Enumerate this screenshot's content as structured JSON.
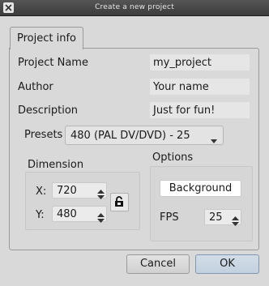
{
  "window": {
    "title": "Create a new project"
  },
  "tabs": [
    {
      "label": "Project info"
    }
  ],
  "form": {
    "project_name_label": "Project Name",
    "project_name_value": "my_project",
    "author_label": "Author",
    "author_value": "Your name",
    "description_label": "Description",
    "description_value": "Just for fun!",
    "presets_label": "Presets",
    "presets_value": "480 (PAL DV/DVD) - 25"
  },
  "dimension": {
    "title": "Dimension",
    "x_label": "X:",
    "x_value": "720",
    "y_label": "Y:",
    "y_value": "480"
  },
  "options": {
    "title": "Options",
    "background_label": "Background",
    "fps_label": "FPS",
    "fps_value": "25"
  },
  "buttons": {
    "cancel": "Cancel",
    "ok": "OK"
  },
  "icons": {
    "close": "close-icon",
    "dropdown": "chevron-down-icon",
    "lock": "lock-icon",
    "spin_up": "arrow-up-icon",
    "spin_down": "arrow-down-icon"
  }
}
